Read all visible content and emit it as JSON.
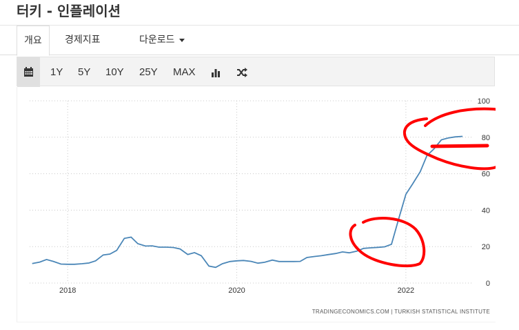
{
  "page": {
    "title": "터키 - 인플레이션"
  },
  "tabs": [
    {
      "label": "개요"
    },
    {
      "label": "경제지표"
    },
    {
      "label": "다운로드"
    }
  ],
  "toolbar": {
    "ranges": [
      "1Y",
      "5Y",
      "10Y",
      "25Y",
      "MAX"
    ],
    "icons": [
      "calendar-icon",
      "bar-chart-icon",
      "shuffle-icon"
    ]
  },
  "chart_data": {
    "type": "line",
    "title": "",
    "xlabel": "",
    "ylabel": "",
    "ylim": [
      0,
      100
    ],
    "y_ticks": [
      0,
      20,
      40,
      60,
      80,
      100
    ],
    "x_ticks": [
      "2018",
      "2020",
      "2022"
    ],
    "x_tick_values": [
      2018,
      2020,
      2022
    ],
    "xlim": [
      2017.55,
      2022.8
    ],
    "grid": true,
    "y_axis_side": "right",
    "line_color": "#4a86b7",
    "annotation_color": "#ff0000",
    "series": [
      {
        "x": [
          2017.58,
          2017.67,
          2017.75,
          2017.83,
          2017.92,
          2018.0,
          2018.08,
          2018.17,
          2018.25,
          2018.33,
          2018.42,
          2018.5,
          2018.58,
          2018.67,
          2018.75,
          2018.83,
          2018.92,
          2019.0,
          2019.08,
          2019.17,
          2019.25,
          2019.33,
          2019.42,
          2019.5,
          2019.58,
          2019.67,
          2019.75,
          2019.83,
          2019.92,
          2020.0,
          2020.08,
          2020.17,
          2020.25,
          2020.33,
          2020.42,
          2020.5,
          2020.58,
          2020.67,
          2020.75,
          2020.83,
          2020.92,
          2021.0,
          2021.08,
          2021.17,
          2021.25,
          2021.33,
          2021.42,
          2021.5,
          2021.58,
          2021.67,
          2021.75,
          2021.83,
          2021.92,
          2022.0,
          2022.08,
          2022.17,
          2022.25,
          2022.33,
          2022.42,
          2022.5,
          2022.58,
          2022.67
        ],
        "values": [
          10.7,
          11.5,
          12.9,
          11.9,
          10.4,
          10.3,
          10.3,
          10.6,
          11.0,
          12.2,
          15.4,
          15.9,
          17.9,
          24.5,
          25.2,
          21.6,
          20.3,
          20.4,
          19.7,
          19.7,
          19.5,
          18.7,
          15.7,
          16.7,
          15.0,
          9.3,
          8.6,
          10.6,
          11.8,
          12.2,
          12.4,
          11.9,
          10.9,
          11.4,
          12.6,
          11.8,
          11.8,
          11.8,
          11.9,
          14.0,
          14.6,
          15.0,
          15.6,
          16.2,
          17.1,
          16.6,
          17.5,
          19.0,
          19.3,
          19.6,
          19.9,
          21.3,
          36.1,
          48.7,
          54.4,
          61.1,
          70.0,
          73.5,
          78.6,
          79.6,
          80.2,
          80.5
        ]
      }
    ],
    "source_label": "TRADINGECONOMICS.COM  |  TURKISH STATISTICAL INSTITUTE"
  }
}
